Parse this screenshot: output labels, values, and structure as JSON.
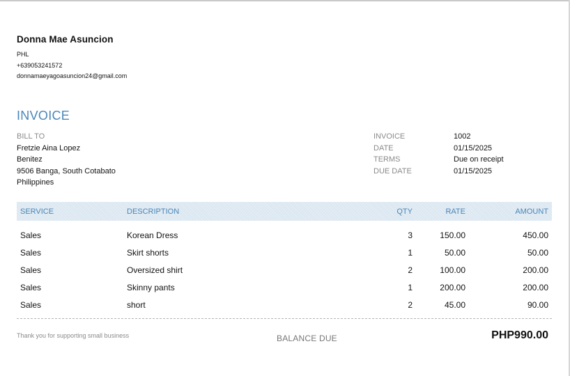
{
  "company": {
    "name": "Donna Mae Asuncion",
    "country": "PHL",
    "phone": "+639053241572",
    "email": "donnamaeyagoasuncion24@gmail.com"
  },
  "invoice_title": "INVOICE",
  "bill_to": {
    "label": "BILL TO",
    "name": "Fretzie Aina Lopez",
    "line1": "Benitez",
    "line2": "9506 Banga, South Cotabato",
    "line3": "Philippines"
  },
  "meta": {
    "invoice_label": "INVOICE",
    "invoice_value": "1002",
    "date_label": "DATE",
    "date_value": "01/15/2025",
    "terms_label": "TERMS",
    "terms_value": "Due on receipt",
    "due_label": "DUE DATE",
    "due_value": "01/15/2025"
  },
  "table": {
    "headers": {
      "service": "SERVICE",
      "description": "DESCRIPTION",
      "qty": "QTY",
      "rate": "RATE",
      "amount": "AMOUNT"
    },
    "rows": [
      {
        "service": "Sales",
        "description": "Korean Dress",
        "qty": "3",
        "rate": "150.00",
        "amount": "450.00"
      },
      {
        "service": "Sales",
        "description": "Skirt shorts",
        "qty": "1",
        "rate": "50.00",
        "amount": "50.00"
      },
      {
        "service": "Sales",
        "description": "Oversized shirt",
        "qty": "2",
        "rate": "100.00",
        "amount": "200.00"
      },
      {
        "service": "Sales",
        "description": "Skinny pants",
        "qty": "1",
        "rate": "200.00",
        "amount": "200.00"
      },
      {
        "service": "Sales",
        "description": "short",
        "qty": "2",
        "rate": "45.00",
        "amount": "90.00"
      }
    ]
  },
  "footer": {
    "thanks": "Thank you for supporting small business",
    "balance_label": "BALANCE DUE",
    "balance_amount": "PHP990.00"
  }
}
